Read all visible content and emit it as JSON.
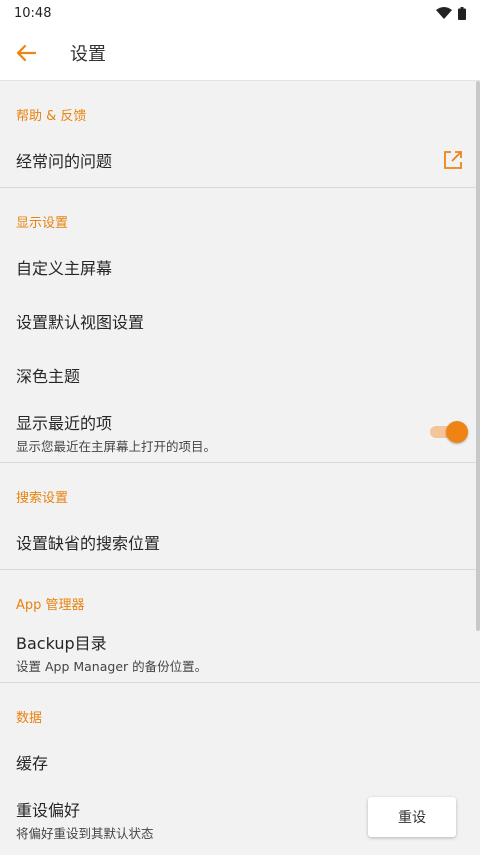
{
  "status_bar": {
    "time": "10:48"
  },
  "app_bar": {
    "title": "设置"
  },
  "sections": {
    "help": {
      "header": "帮助 & 反馈",
      "faq": "经常问的问题"
    },
    "display": {
      "header": "显示设置",
      "custom_home": "自定义主屏幕",
      "default_view": "设置默认视图设置",
      "dark_theme": "深色主题",
      "recent_items_title": "显示最近的项",
      "recent_items_desc": "显示您最近在主屏幕上打开的项目。",
      "recent_items_enabled": true
    },
    "search": {
      "header": "搜索设置",
      "default_location": "设置缺省的搜索位置"
    },
    "app_manager": {
      "header": "App 管理器",
      "backup_title": "Backup目录",
      "backup_desc": "设置 App Manager 的备份位置。"
    },
    "data": {
      "header": "数据",
      "cache": "缓存",
      "reset_prefs_title": "重设偏好",
      "reset_prefs_desc": "将偏好重设到其默认状态",
      "reset_button": "重设"
    }
  },
  "colors": {
    "accent": "#EF8314",
    "accent_light": "#F5C59A"
  }
}
